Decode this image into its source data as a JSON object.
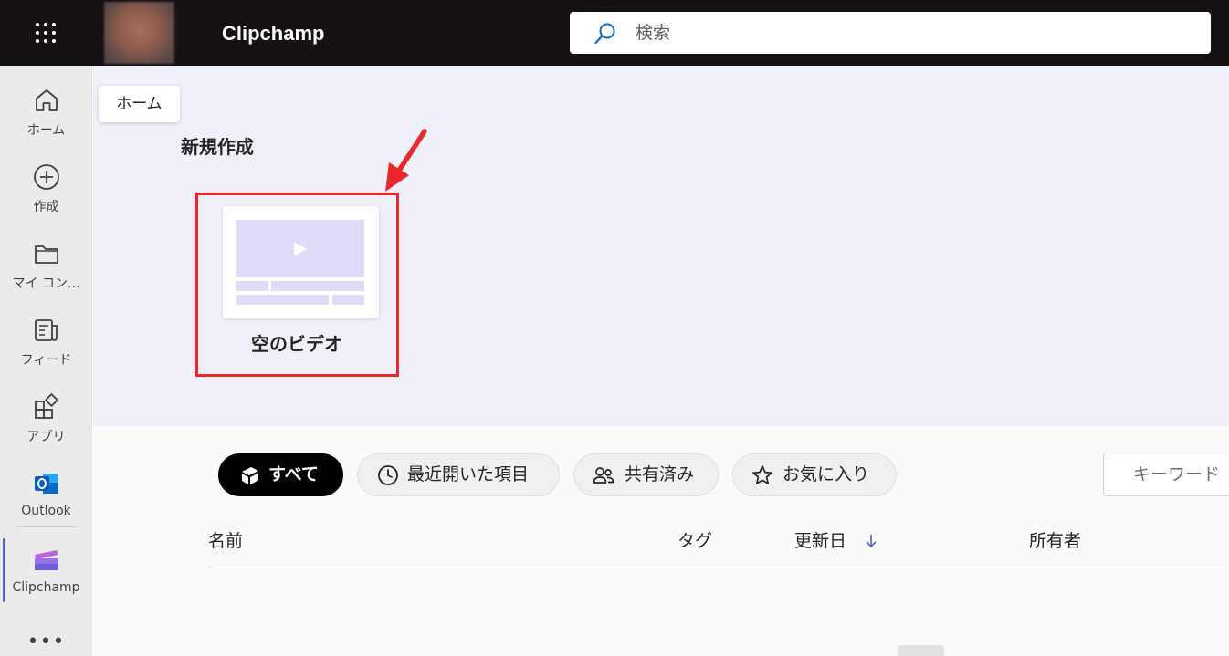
{
  "topbar": {
    "app_title": "Clipchamp",
    "search_placeholder": "検索",
    "launcher_icon": "waffle-icon",
    "avatar": "user-avatar-blurred"
  },
  "rail": {
    "items": [
      {
        "label": "ホーム",
        "icon": "home-icon"
      },
      {
        "label": "作成",
        "icon": "add-circle-icon"
      },
      {
        "label": "マイ コン...",
        "icon": "folder-icon"
      },
      {
        "label": "フィード",
        "icon": "feed-icon"
      },
      {
        "label": "アプリ",
        "icon": "apps-icon"
      },
      {
        "label": "Outlook",
        "icon": "outlook-icon"
      },
      {
        "label": "Clipchamp",
        "icon": "clipchamp-icon"
      }
    ],
    "more": "•••",
    "active_color": "#5b5fc7"
  },
  "tooltip": {
    "text": "ホーム"
  },
  "create": {
    "section_title": "新規作成",
    "blank_video_label": "空のビデオ",
    "highlight_color": "#e8282a"
  },
  "filters": [
    {
      "label": "すべて",
      "icon": "stack-icon",
      "active": true
    },
    {
      "label": "最近開いた項目",
      "icon": "clock-icon",
      "active": false
    },
    {
      "label": "共有済み",
      "icon": "people-icon",
      "active": false
    },
    {
      "label": "お気に入り",
      "icon": "star-icon",
      "active": false
    }
  ],
  "keyword_placeholder": "キーワード",
  "table": {
    "columns": [
      "名前",
      "タグ",
      "更新日",
      "所有者"
    ],
    "sort_icon": "arrow-down-icon"
  }
}
